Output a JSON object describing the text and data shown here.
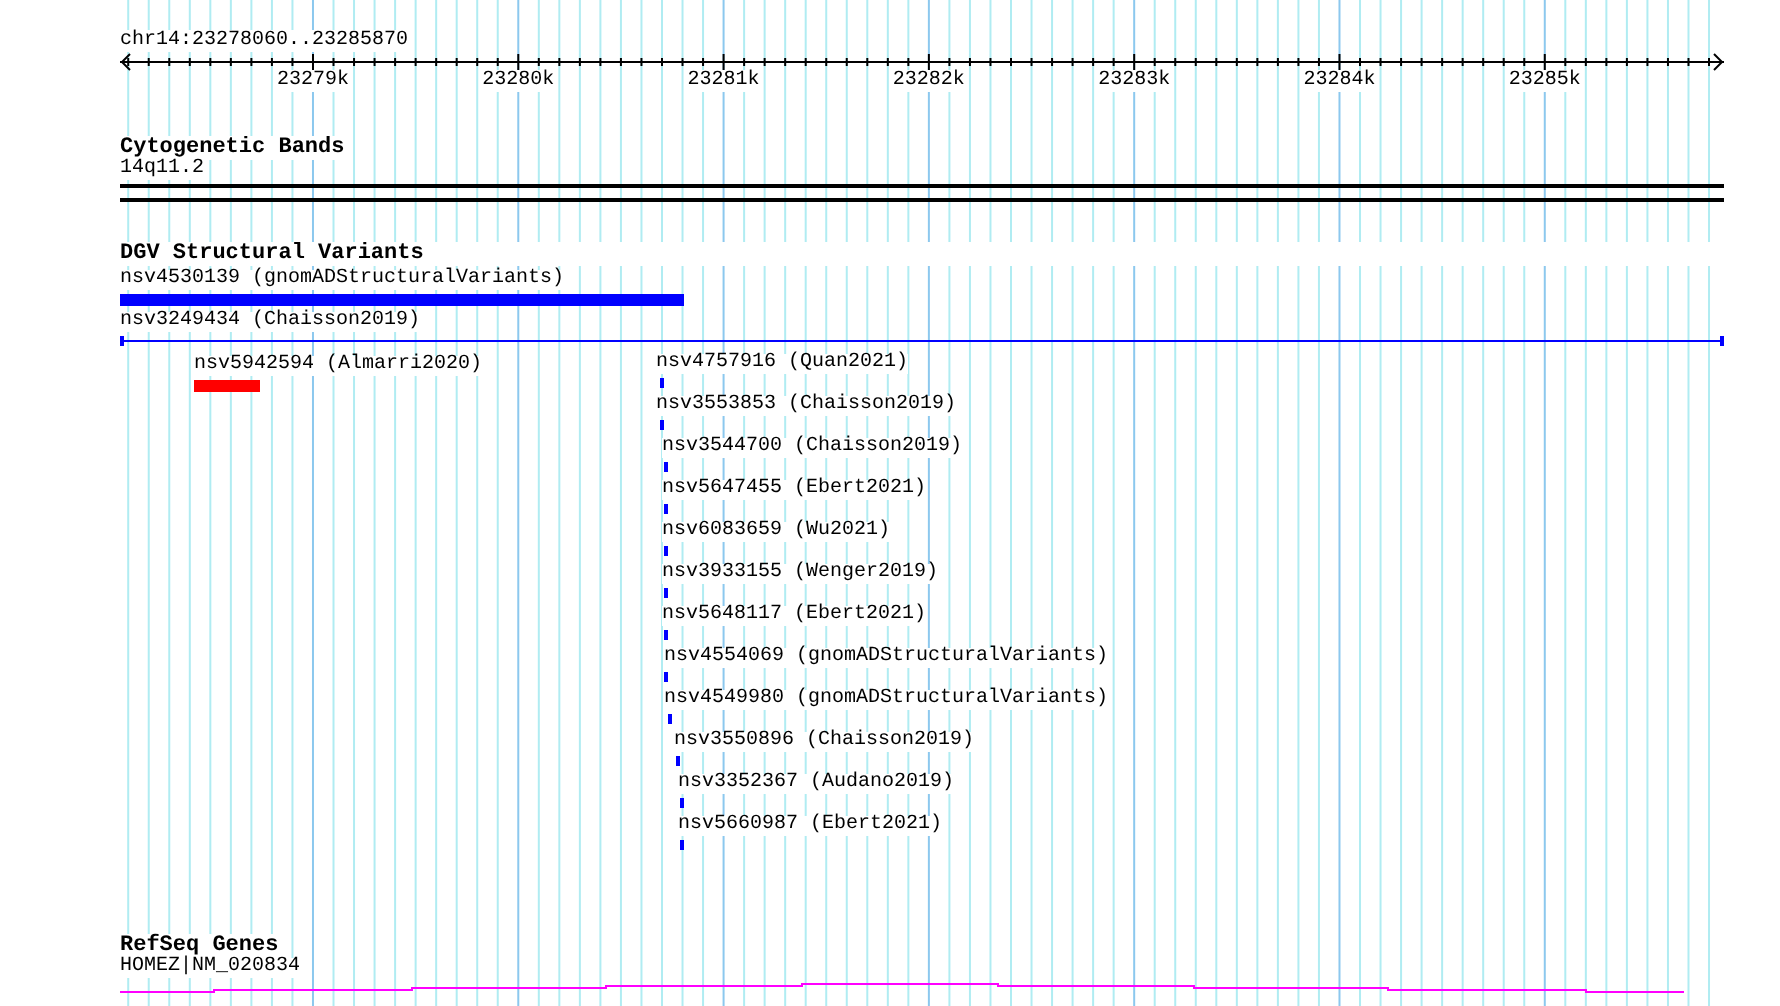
{
  "ruler": {
    "location": "chr14:23278060..23285870",
    "ticks": [
      "23279k",
      "23280k",
      "23281k",
      "23282k",
      "23283k",
      "23284k",
      "23285k"
    ]
  },
  "tracks": [
    {
      "kind": "band",
      "title": "Cytogenetic Bands",
      "label": "14q11.2"
    },
    {
      "kind": "variants",
      "title": "DGV Structural Variants",
      "features": [
        {
          "label": "nsv4530139 (gnomADStructuralVariants)",
          "color": "#0000ff"
        },
        {
          "label": "nsv3249434 (Chaisson2019)",
          "color": "#0000ff"
        },
        {
          "label": "nsv5942594 (Almarri2020)",
          "color": "#ff0000"
        },
        {
          "label": "nsv4757916 (Quan2021)",
          "color": "#0000ff"
        },
        {
          "label": "nsv3553853 (Chaisson2019)",
          "color": "#0000ff"
        },
        {
          "label": "nsv3544700 (Chaisson2019)",
          "color": "#0000ff"
        },
        {
          "label": "nsv5647455 (Ebert2021)",
          "color": "#0000ff"
        },
        {
          "label": "nsv6083659 (Wu2021)",
          "color": "#0000ff"
        },
        {
          "label": "nsv3933155 (Wenger2019)",
          "color": "#0000ff"
        },
        {
          "label": "nsv5648117 (Ebert2021)",
          "color": "#0000ff"
        },
        {
          "label": "nsv4554069 (gnomADStructuralVariants)",
          "color": "#0000ff"
        },
        {
          "label": "nsv4549980 (gnomADStructuralVariants)",
          "color": "#0000ff"
        },
        {
          "label": "nsv3550896 (Chaisson2019)",
          "color": "#0000ff"
        },
        {
          "label": "nsv3352367 (Audano2019)",
          "color": "#0000ff"
        },
        {
          "label": "nsv5660987 (Ebert2021)",
          "color": "#0000ff"
        }
      ]
    },
    {
      "kind": "gene",
      "title": "RefSeq Genes",
      "label": "HOMEZ|NM_020834"
    }
  ]
}
